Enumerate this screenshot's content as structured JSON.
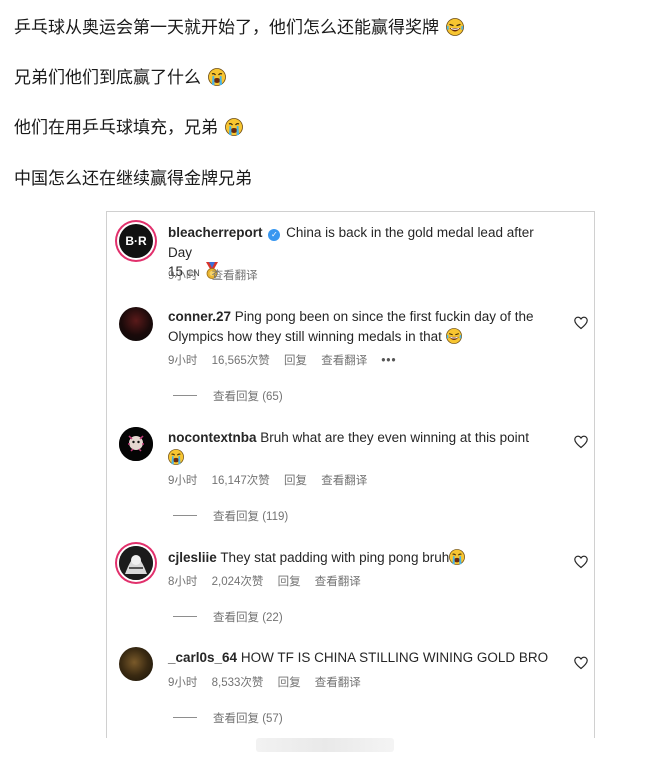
{
  "post_lines": [
    "乒乓球从奥运会第一天就开始了，他们怎么还能赢得奖牌",
    "兄弟们他们到底赢了什么",
    "他们在用乒乓球填充，兄弟",
    "中国怎么还在继续赢得金牌兄弟"
  ],
  "main_comment": {
    "username": "bleacherreport",
    "avatar_text": "B·R",
    "text_a": "China is back in the gold medal lead after Day",
    "text_b": "15",
    "flag_text": "CN",
    "time": "9小时",
    "translate": "查看翻译"
  },
  "comments": [
    {
      "username": "conner.27",
      "text_a": "Ping pong been on since the first fuckin day of the",
      "text_b": "Olympics how they still winning medals in that",
      "time": "9小时",
      "likes": "16,565次赞",
      "reply": "回复",
      "translate": "查看翻译",
      "more": "•••",
      "view_replies": "查看回复 (65)"
    },
    {
      "username": "nocontextnba",
      "text_a": "Bruh what are they even winning at this point",
      "time": "9小时",
      "likes": "16,147次赞",
      "reply": "回复",
      "translate": "查看翻译",
      "view_replies": "查看回复 (119)"
    },
    {
      "username": "cjlesliie",
      "text_a": "They stat padding with ping pong bruh",
      "time": "8小时",
      "likes": "2,024次赞",
      "reply": "回复",
      "translate": "查看翻译",
      "view_replies": "查看回复 (22)"
    },
    {
      "username": "_carl0s_64",
      "text_a": "HOW TF IS CHINA STILLING WINING GOLD BRO",
      "time": "9小时",
      "likes": "8,533次赞",
      "reply": "回复",
      "translate": "查看翻译",
      "view_replies": "查看回复 (57)"
    }
  ],
  "colors": {
    "meta": "#737373",
    "verified": "#3897f0",
    "ring": "#e1306c"
  }
}
